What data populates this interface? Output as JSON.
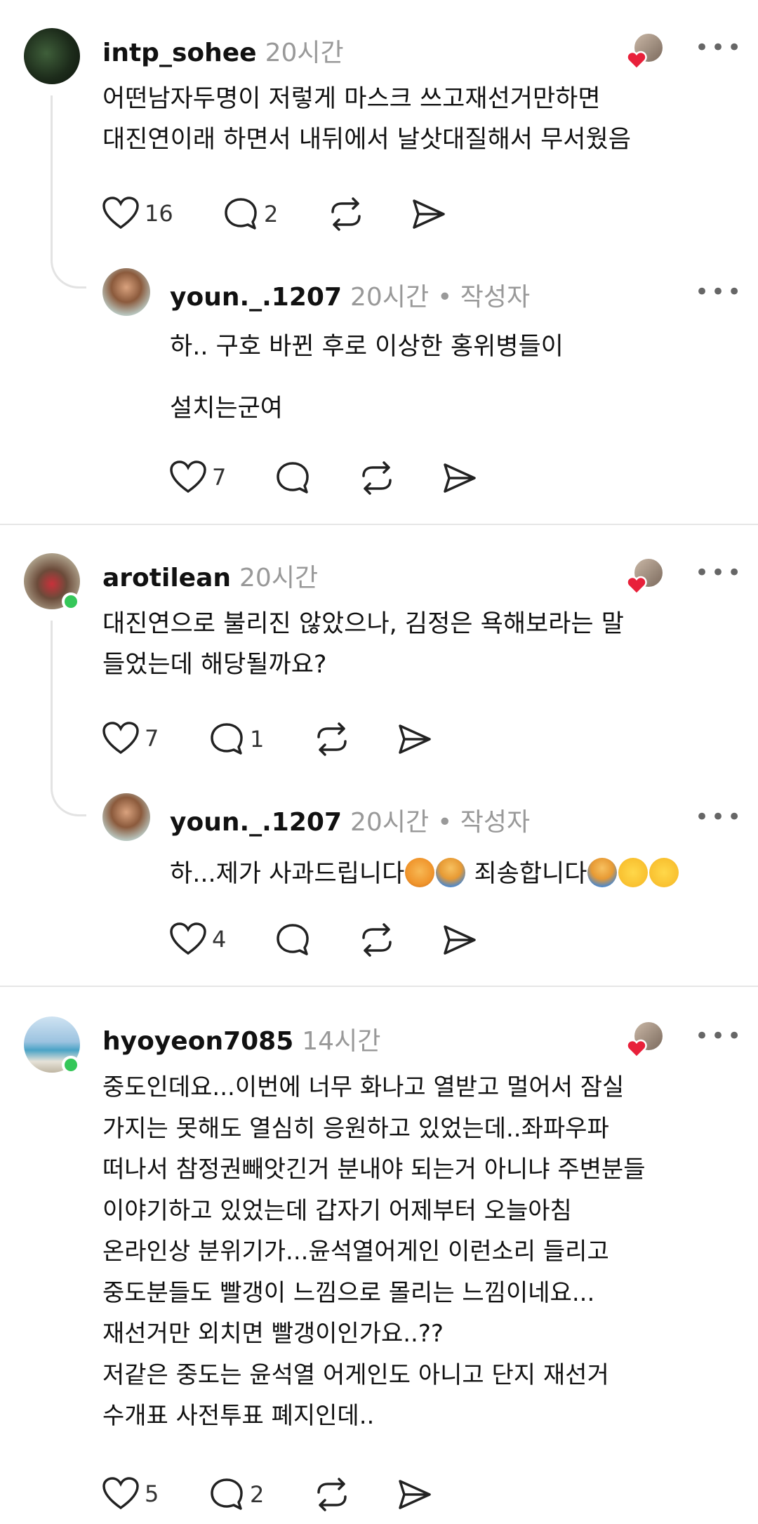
{
  "comments": [
    {
      "username": "intp_sohee",
      "time": "20시간",
      "text": "어떤남자두명이 저렇게 마스크 쓰고재선거만하면\n대진연이래 하면서 내뒤에서 날삿대질해서 무서웠음",
      "likes": "16",
      "replies_count": "2",
      "reply": {
        "username": "youn._.1207",
        "time": "20시간",
        "author_tag": "• 작성자",
        "line1": "하.. 구호 바뀐 후로 이상한 홍위병들이",
        "line2": "설치는군여",
        "likes": "7"
      }
    },
    {
      "username": "arotilean",
      "time": "20시간",
      "text": "대진연으로 불리진 않았으나, 김정은 욕해보라는 말\n들었는데 해당될까요?",
      "likes": "7",
      "replies_count": "1",
      "reply": {
        "username": "youn._.1207",
        "time": "20시간",
        "author_tag": "• 작성자",
        "line1a": "하...제가 사과드립니다",
        "line1b": " 죄송합니다",
        "likes": "4"
      }
    },
    {
      "username": "hyoyeon7085",
      "time": "14시간",
      "text": "중도인데요...이번에 너무 화나고 열받고 멀어서 잠실\n가지는 못해도 열심히 응원하고 있었는데..좌파우파\n떠나서 참정권빼앗긴거 분내야 되는거 아니냐 주변분들\n이야기하고 있었는데 갑자기 어제부터 오늘아침\n온라인상 분위기가...윤석열어게인 이런소리 들리고\n중도분들도 빨갱이 느낌으로 몰리는 느낌이네요...\n재선거만 외치면 빨갱이인가요..??\n저같은 중도는 윤석열 어게인도 아니고 단지 재선거\n수개표 사전투표 폐지인데..",
      "likes": "5",
      "replies_count": "2"
    }
  ],
  "icons": {
    "more": "more-options-icon",
    "like": "heart-icon",
    "reply": "comment-icon",
    "repost": "repost-icon",
    "share": "send-icon",
    "liked_by_author": "liked-by-author-icon",
    "verified_online": "online-status-dot"
  },
  "colors": {
    "text": "#111111",
    "muted": "#999999",
    "like_heart": "#e8203a",
    "online": "#35c759",
    "divider": "#e6e6e6"
  }
}
